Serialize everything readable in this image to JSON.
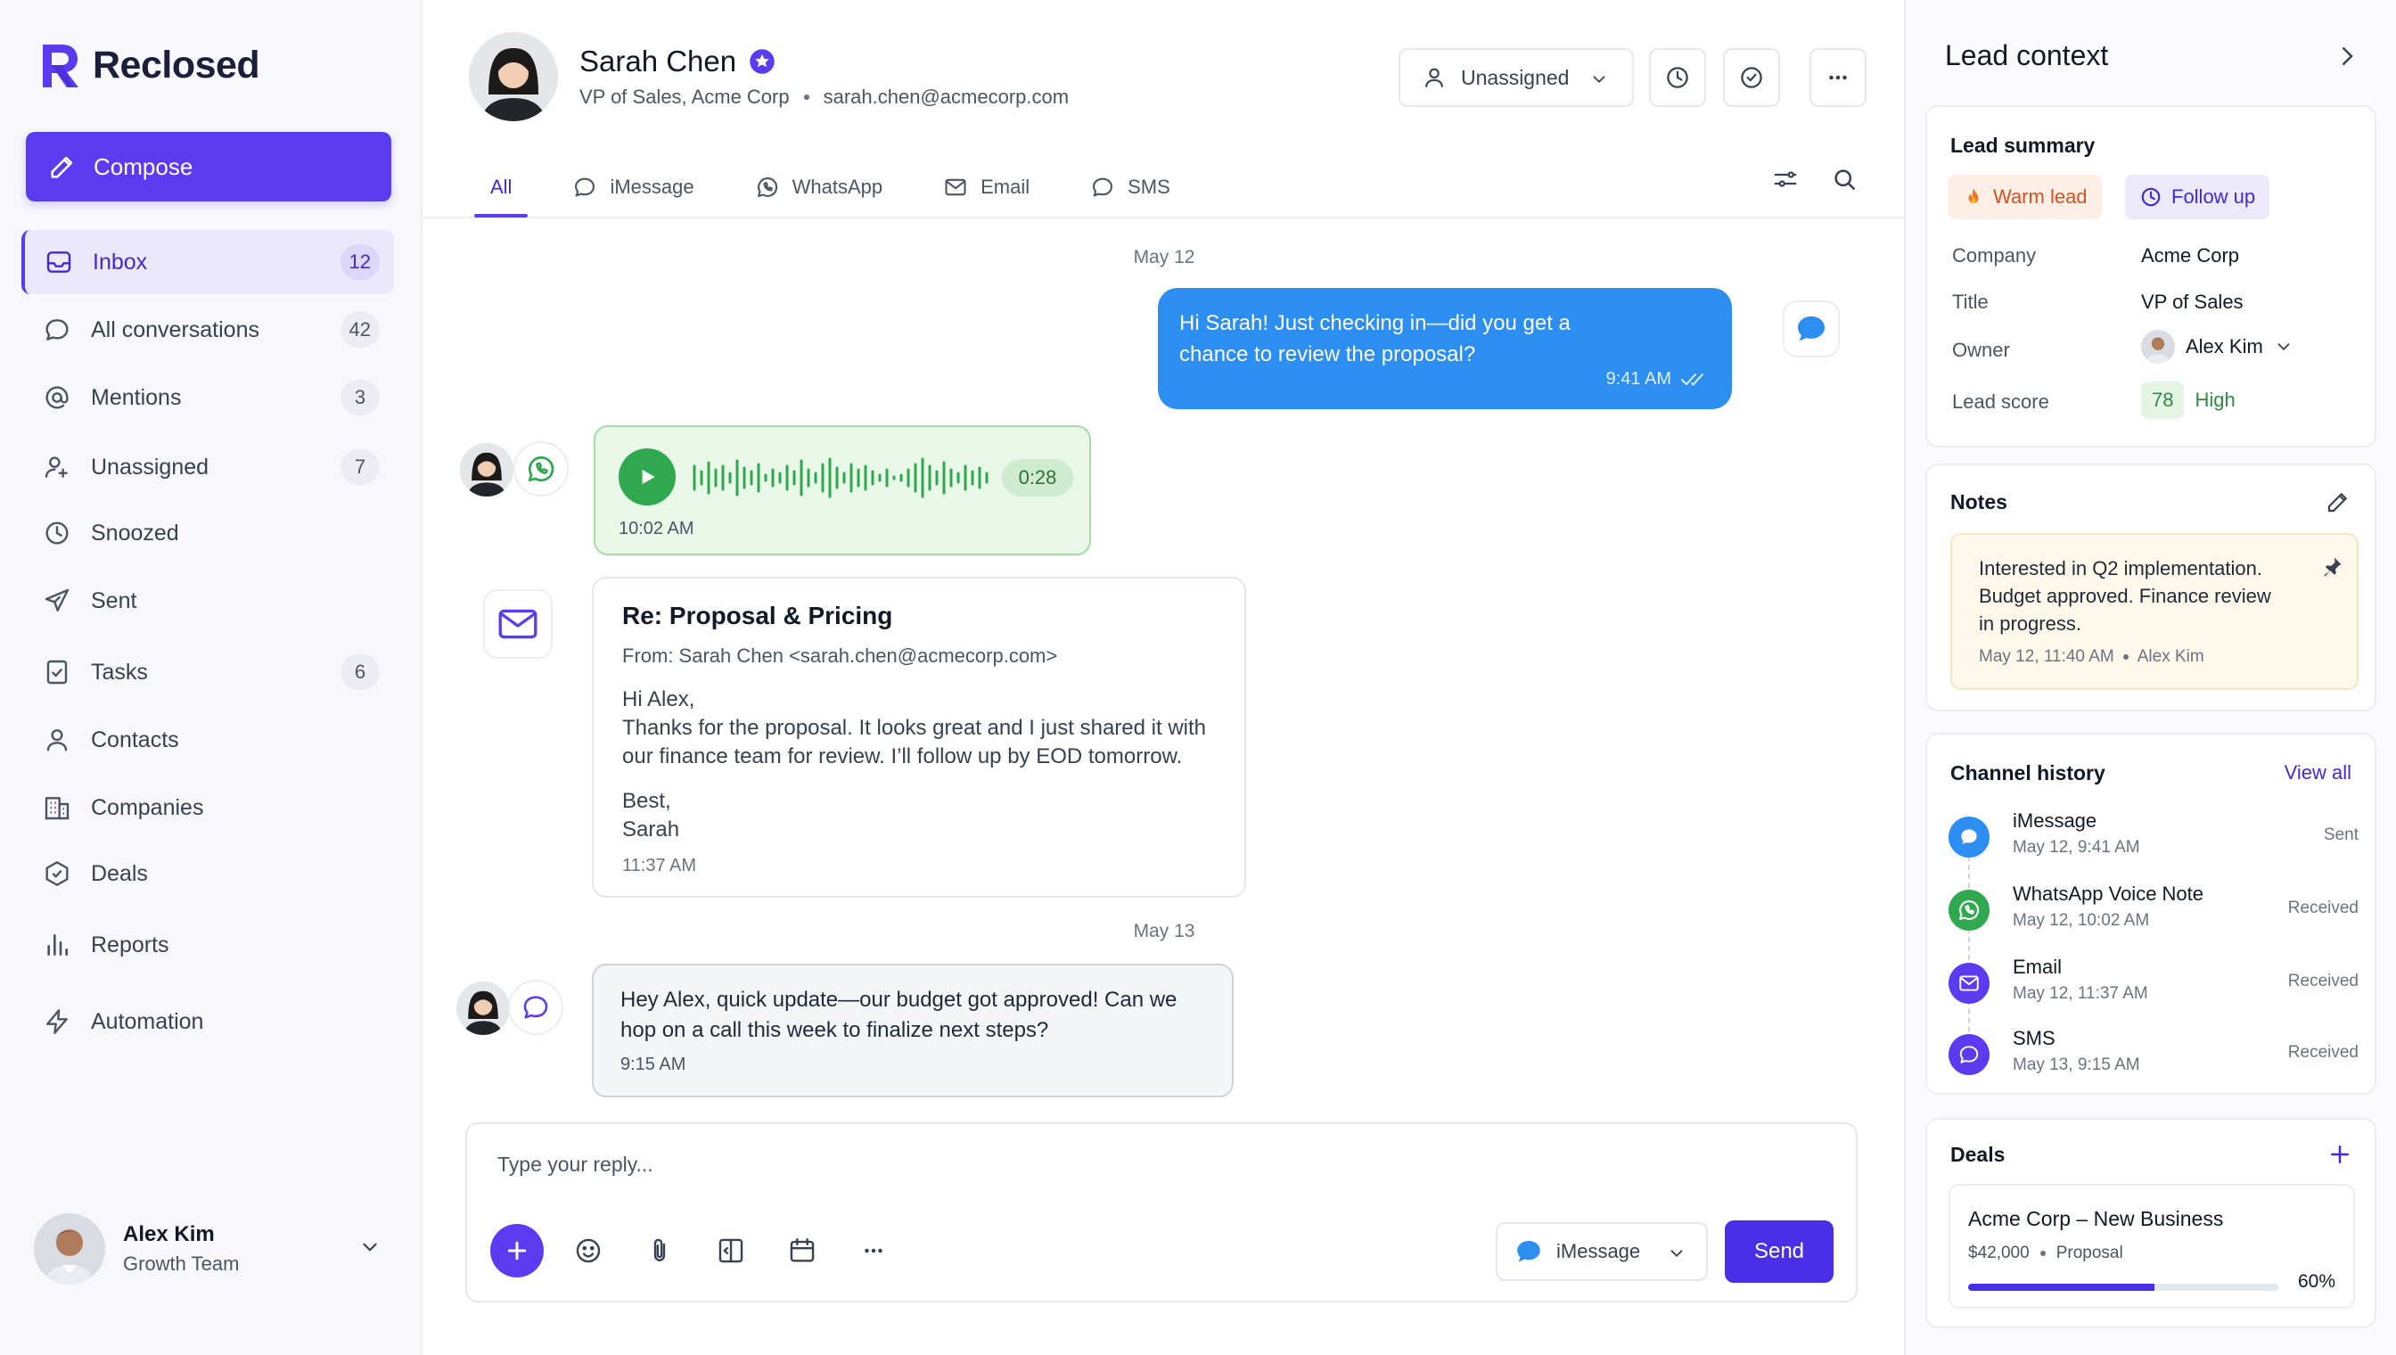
{
  "app": {
    "name": "Reclosed"
  },
  "colors": {
    "accent": "#5b3bf0",
    "imessage": "#2b8ef0",
    "whatsapp": "#2fa84f",
    "warm": "#e46d2c",
    "score": "#2fa84f"
  },
  "sidebar": {
    "compose_label": "Compose",
    "items": [
      {
        "label": "Inbox",
        "count": "12",
        "icon": "inbox-icon"
      },
      {
        "label": "All conversations",
        "count": "42",
        "icon": "chat-bubble-icon"
      },
      {
        "label": "Mentions",
        "count": "3",
        "icon": "at-sign-icon"
      },
      {
        "label": "Unassigned",
        "count": "7",
        "icon": "user-plus-icon"
      },
      {
        "label": "Snoozed",
        "count": "",
        "icon": "clock-icon"
      },
      {
        "label": "Sent",
        "count": "",
        "icon": "send-icon"
      },
      {
        "label": "Tasks",
        "count": "6",
        "icon": "checkbox-icon"
      },
      {
        "label": "Contacts",
        "count": "",
        "icon": "person-icon"
      },
      {
        "label": "Companies",
        "count": "",
        "icon": "building-icon"
      },
      {
        "label": "Deals",
        "count": "",
        "icon": "hexagon-check-icon"
      },
      {
        "label": "Reports",
        "count": "",
        "icon": "bar-chart-icon"
      },
      {
        "label": "Automation",
        "count": "",
        "icon": "lightning-icon"
      }
    ],
    "user": {
      "name": "Alex Kim",
      "team": "Growth Team"
    }
  },
  "header": {
    "contact_name": "Sarah Chen",
    "contact_title": "VP of Sales, Acme Corp",
    "contact_email": "sarah.chen@acmecorp.com",
    "assign_label": "Unassigned",
    "tabs": [
      {
        "label": "All",
        "icon": ""
      },
      {
        "label": "iMessage",
        "icon": "chat-bubble-icon"
      },
      {
        "label": "WhatsApp",
        "icon": "whatsapp-icon"
      },
      {
        "label": "Email",
        "icon": "mail-icon"
      },
      {
        "label": "SMS",
        "icon": "chat-bubble-icon"
      }
    ]
  },
  "conversation": {
    "date1": "May 12",
    "imessage": {
      "text": "Hi Sarah! Just checking in—did you get a chance to review the proposal?",
      "time": "9:41 AM"
    },
    "voice": {
      "duration": "0:28",
      "time": "10:02 AM"
    },
    "email": {
      "subject": "Re: Proposal & Pricing",
      "from": "From: Sarah Chen <sarah.chen@acmecorp.com>",
      "greeting": "Hi Alex,",
      "body": "Thanks for the proposal. It looks great and I just shared it with our finance team for review. I’ll follow up by EOD tomorrow.",
      "signoff": "Best,",
      "signature": "Sarah",
      "time": "11:37 AM"
    },
    "date2": "May 13",
    "sms": {
      "text": "Hey Alex, quick update—our budget got approved! Can we hop on a call this week to finalize next steps?",
      "time": "9:15 AM"
    }
  },
  "composer": {
    "placeholder": "Type your reply...",
    "channel": "iMessage",
    "send_label": "Send"
  },
  "lead": {
    "title": "Lead context",
    "summary": {
      "title": "Lead summary",
      "warm_label": "Warm lead",
      "follow_label": "Follow up",
      "company_k": "Company",
      "company_v": "Acme Corp",
      "title_k": "Title",
      "title_v": "VP of Sales",
      "owner_k": "Owner",
      "owner_v": "Alex Kim",
      "score_k": "Lead score",
      "score_v": "78",
      "score_level": "High"
    },
    "notes": {
      "title": "Notes",
      "text": "Interested in Q2 implementation. Budget approved. Finance review in progress.",
      "date": "May 12, 11:40 AM",
      "author": "Alex Kim"
    },
    "history": {
      "title": "Channel history",
      "view_all": "View all",
      "items": [
        {
          "name": "iMessage",
          "time": "May 12, 9:41 AM",
          "status": "Sent",
          "color": "#2b8ef0"
        },
        {
          "name": "WhatsApp Voice Note",
          "time": "May 12, 10:02 AM",
          "status": "Received",
          "color": "#2fa84f"
        },
        {
          "name": "Email",
          "time": "May 12, 11:37 AM",
          "status": "Received",
          "color": "#5b3bf0"
        },
        {
          "name": "SMS",
          "time": "May 13, 9:15 AM",
          "status": "Received",
          "color": "#5b3bf0"
        }
      ]
    },
    "deals": {
      "title": "Deals",
      "name": "Acme Corp – New Business",
      "amount": "$42,000",
      "stage": "Proposal",
      "progress_label": "60%",
      "progress": 0.6
    }
  }
}
